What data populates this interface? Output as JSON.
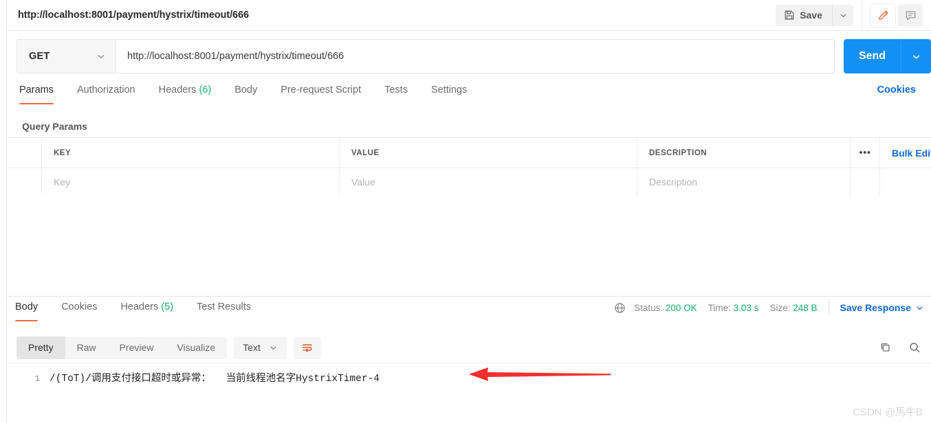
{
  "topbar": {
    "request_title": "http://localhost:8001/payment/hystrix/timeout/666",
    "save_label": "Save",
    "save_icon": "floppy-disk-icon",
    "save_caret_icon": "chevron-down-icon",
    "edit_icon": "pencil-icon",
    "comment_icon": "comment-icon",
    "accent_orange": "#f26b3a"
  },
  "url_row": {
    "method": "GET",
    "method_caret_icon": "chevron-down-icon",
    "url": "http://localhost:8001/payment/hystrix/timeout/666",
    "send_label": "Send",
    "send_caret_icon": "chevron-down-icon",
    "send_color": "#1390f5"
  },
  "request_tabs": {
    "items": [
      {
        "label": "Params",
        "count": "",
        "active": true
      },
      {
        "label": "Authorization",
        "count": "",
        "active": false
      },
      {
        "label": "Headers",
        "count": "(6)",
        "active": false
      },
      {
        "label": "Body",
        "count": "",
        "active": false
      },
      {
        "label": "Pre-request Script",
        "count": "",
        "active": false
      },
      {
        "label": "Tests",
        "count": "",
        "active": false
      },
      {
        "label": "Settings",
        "count": "",
        "active": false
      }
    ],
    "cookies_link": "Cookies"
  },
  "query_params": {
    "section_label": "Query Params",
    "headers": {
      "key": "KEY",
      "value": "VALUE",
      "description": "DESCRIPTION"
    },
    "more_icon": "ellipsis-icon",
    "bulk_edit_label": "Bulk Edit",
    "rows": [
      {
        "key_placeholder": "Key",
        "value_placeholder": "Value",
        "desc_placeholder": "Description"
      }
    ]
  },
  "response_tabs": {
    "items": [
      {
        "label": "Body",
        "count": "",
        "active": true
      },
      {
        "label": "Cookies",
        "count": "",
        "active": false
      },
      {
        "label": "Headers",
        "count": "(5)",
        "active": false
      },
      {
        "label": "Test Results",
        "count": "",
        "active": false
      }
    ],
    "globe_icon": "globe-icon",
    "meta": {
      "status_label": "Status:",
      "status_value": "200 OK",
      "time_label": "Time:",
      "time_value": "3.03 s",
      "size_label": "Size:",
      "size_value": "248 B",
      "ok_color": "#1bab6c"
    },
    "save_response_label": "Save Response",
    "save_response_caret_icon": "chevron-down-icon"
  },
  "response_toolbar": {
    "view_modes": [
      {
        "label": "Pretty",
        "active": true
      },
      {
        "label": "Raw",
        "active": false
      },
      {
        "label": "Preview",
        "active": false
      },
      {
        "label": "Visualize",
        "active": false
      }
    ],
    "format": "Text",
    "format_caret_icon": "chevron-down-icon",
    "wrap_icon": "word-wrap-icon",
    "copy_icon": "copy-icon",
    "search_icon": "search-icon"
  },
  "response_body": {
    "line_number": "1",
    "text": "/(ToT)/调用支付接口超时或异常：　　当前线程池名字HystrixTimer-4"
  },
  "annotation": {
    "arrow_icon": "red-left-arrow-annotation",
    "arrow_color": "#f42f2f"
  },
  "watermark": {
    "text": "CSDN @馬牛B"
  }
}
